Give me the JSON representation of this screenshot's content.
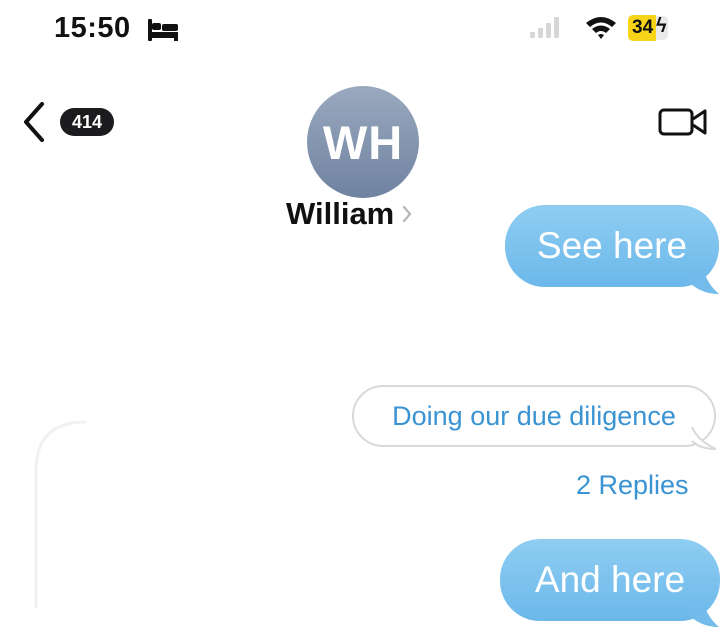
{
  "status_bar": {
    "time": "15:50",
    "focus_icon": "bed-icon",
    "signal_icon": "cellular-signal-icon",
    "wifi_icon": "wifi-icon",
    "battery_level": "34",
    "battery_charging": true,
    "battery_color": "#f7d417"
  },
  "header": {
    "back_icon": "chevron-left-icon",
    "unread_count": "414",
    "avatar_initials": "WH",
    "contact_name": "William",
    "video_icon": "video-camera-icon"
  },
  "messages": [
    {
      "text": "See here",
      "direction": "outgoing",
      "style": "filled"
    },
    {
      "text": "Doing our due diligence",
      "direction": "outgoing",
      "style": "outline",
      "replies": "2 Replies"
    },
    {
      "text": "And here",
      "direction": "outgoing",
      "style": "filled"
    }
  ],
  "colors": {
    "bubble_fill": "#7cc2ee",
    "link_blue": "#3a93d3",
    "avatar": "#7f91ad"
  }
}
